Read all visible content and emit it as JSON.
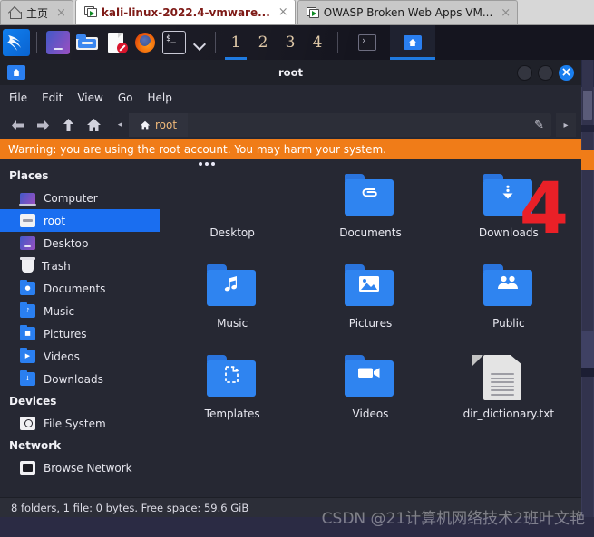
{
  "vmware": {
    "tabs": [
      {
        "label": "主页",
        "icon": "home-icon",
        "active": false,
        "close": "×"
      },
      {
        "label": "kali-linux-2022.4-vmware...",
        "icon": "vm-screen-icon",
        "active": true,
        "close": "×"
      },
      {
        "label": "OWASP Broken Web Apps VM...",
        "icon": "vm-screen-icon",
        "active": false,
        "close": "×"
      }
    ]
  },
  "taskbar": {
    "logo": "kali-dragon-logo",
    "launchers": [
      {
        "name": "show-desktop-icon"
      },
      {
        "name": "file-manager-icon"
      },
      {
        "name": "text-editor-icon"
      },
      {
        "name": "firefox-icon"
      },
      {
        "name": "terminal-icon"
      }
    ],
    "chevron": "chevron-down-icon",
    "workspaces": [
      {
        "label": "1",
        "active": true
      },
      {
        "label": "2",
        "active": false
      },
      {
        "label": "3",
        "active": false
      },
      {
        "label": "4",
        "active": false
      }
    ],
    "windows": [
      {
        "name": "terminal-window-button",
        "active": false
      },
      {
        "name": "file-manager-window-button",
        "active": true
      }
    ]
  },
  "window": {
    "title": "root",
    "icon": "folder-home-icon",
    "controls": {
      "minimize": "minimize-button",
      "maximize": "maximize-button",
      "close": "×"
    },
    "menus": [
      "File",
      "Edit",
      "View",
      "Go",
      "Help"
    ],
    "toolbar": {
      "back": "back-icon",
      "forward": "forward-icon",
      "up": "up-icon",
      "home": "home-icon",
      "crumb_scroll_left": "◂",
      "crumb_scroll_right": "▸",
      "current_crumb": "root",
      "path_value": "",
      "path_placeholder": "",
      "edit_path": "pencil-icon"
    },
    "warning": "Warning: you are using the root account. You may harm your system.",
    "status": "8 folders, 1 file: 0 bytes. Free space: 59.6 GiB"
  },
  "sidebar": {
    "sections": [
      {
        "heading": "Places",
        "items": [
          {
            "label": "Computer",
            "icon": "computer-icon",
            "selected": false
          },
          {
            "label": "root",
            "icon": "home-folder-icon",
            "selected": true
          },
          {
            "label": "Desktop",
            "icon": "desktop-icon",
            "selected": false
          },
          {
            "label": "Trash",
            "icon": "trash-icon",
            "selected": false
          },
          {
            "label": "Documents",
            "icon": "documents-folder-icon",
            "selected": false
          },
          {
            "label": "Music",
            "icon": "music-folder-icon",
            "selected": false
          },
          {
            "label": "Pictures",
            "icon": "pictures-folder-icon",
            "selected": false
          },
          {
            "label": "Videos",
            "icon": "videos-folder-icon",
            "selected": false
          },
          {
            "label": "Downloads",
            "icon": "downloads-folder-icon",
            "selected": false
          }
        ]
      },
      {
        "heading": "Devices",
        "items": [
          {
            "label": "File System",
            "icon": "disk-icon",
            "selected": false
          }
        ]
      },
      {
        "heading": "Network",
        "items": [
          {
            "label": "Browse Network",
            "icon": "network-icon",
            "selected": false
          }
        ]
      }
    ]
  },
  "files": [
    {
      "name": "Desktop",
      "type": "desktop-tile"
    },
    {
      "name": "Documents",
      "type": "folder-documents"
    },
    {
      "name": "Downloads",
      "type": "folder-downloads"
    },
    {
      "name": "Music",
      "type": "folder-music"
    },
    {
      "name": "Pictures",
      "type": "folder-pictures"
    },
    {
      "name": "Public",
      "type": "folder-public"
    },
    {
      "name": "Templates",
      "type": "folder-templates"
    },
    {
      "name": "Videos",
      "type": "folder-videos"
    },
    {
      "name": "dir_dictionary.txt",
      "type": "text-file"
    }
  ],
  "annotation": {
    "number": "4",
    "color": "#ea2027"
  },
  "watermark": "CSDN @21计算机网络技术2班叶文艳",
  "colors": {
    "accent": "#1a6ef0",
    "warning": "#f07c18",
    "window_bg": "#262833",
    "titlebar_bg": "#1f2129",
    "folder_blue": "#2f84f0",
    "crumb_text": "#f0b97a"
  }
}
